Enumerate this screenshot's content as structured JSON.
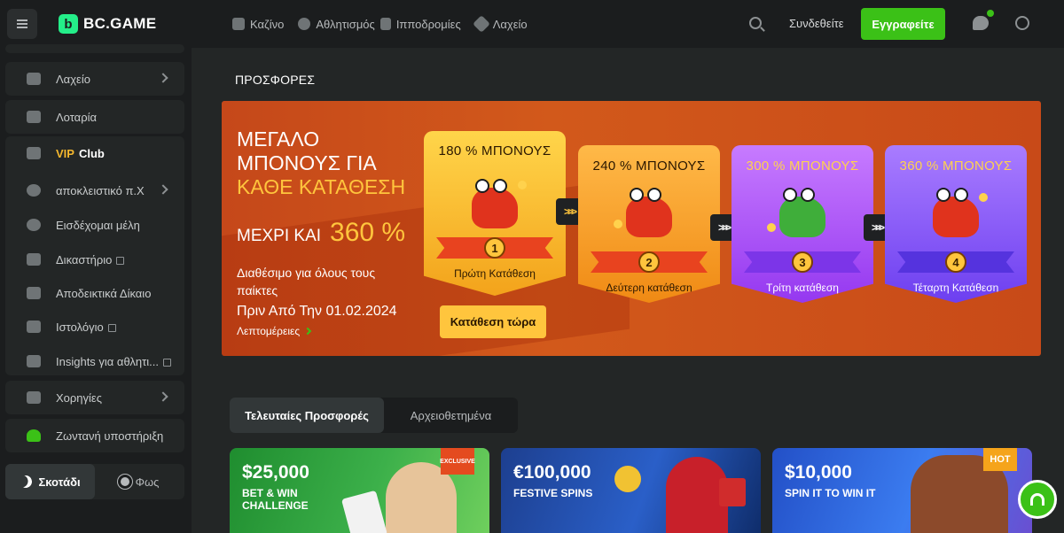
{
  "header": {
    "logo_text": "BC.GAME",
    "nav": [
      {
        "label": "Καζίνο",
        "icon": "casino-icon"
      },
      {
        "label": "Αθλητισμός",
        "icon": "sports-icon"
      },
      {
        "label": "Ιπποδρομίες",
        "icon": "horse-racing-icon"
      },
      {
        "label": "Λαχείο",
        "icon": "lottery-icon"
      }
    ],
    "login_label": "Συνδεθείτε",
    "register_label": "Εγγραφείτε"
  },
  "sidebar": {
    "items": [
      {
        "label": "Λαχείο",
        "icon": "ticket-icon"
      },
      {
        "label": "Λοταρία",
        "icon": "lottery-balls-icon"
      },
      {
        "label_vip": "VIP",
        "label_club": "Club",
        "icon": "crown-icon"
      },
      {
        "label": "αποκλειστικό π.Χ",
        "icon": "medal-icon"
      },
      {
        "label": "Εισδέχομαι μέλη",
        "icon": "referral-icon"
      },
      {
        "label": "Δικαστήριο",
        "icon": "court-icon"
      },
      {
        "label": "Αποδεικτικά Δίκαιο",
        "icon": "fairness-icon"
      },
      {
        "label": "Ιστολόγιο",
        "icon": "blog-icon"
      },
      {
        "label": "Insights για αθλητι...",
        "icon": "insights-icon"
      },
      {
        "label": "Χορηγίες",
        "icon": "sponsorship-icon"
      },
      {
        "label": "Ζωντανή υποστήριξη",
        "icon": "headset-icon"
      }
    ],
    "theme_dark": "Σκοτάδι",
    "theme_light": "Φως"
  },
  "main": {
    "title": "ΠΡΟΣΦΟΡΕΣ",
    "banner": {
      "title_line1": "ΜΕΓΑΛΟ",
      "title_line2": "ΜΠΟΝΟΥΣ ΓΙΑ",
      "title_line3": "ΚΑΘΕ ΚΑΤΑΘΕΣΗ",
      "upto_label": "ΜΕΧΡΙ ΚΑΙ",
      "upto_value": "360 %",
      "available": "Διαθέσιμο για όλους τους παίκτες",
      "date": "Πριν Από Την 01.02.2024",
      "more": "Λεπτομέρειες",
      "deposit_button": "Κατάθεση τώρα",
      "cards": [
        {
          "title": "180 % ΜΠΟΝΟΥΣ",
          "number": "1",
          "label": "Πρώτη Κατάθεση"
        },
        {
          "title": "240 % ΜΠΟΝΟΥΣ",
          "number": "2",
          "label": "Δεύτερη κατάθεση"
        },
        {
          "title": "300 % ΜΠΟΝΟΥΣ",
          "number": "3",
          "label": "Τρίτη κατάθεση"
        },
        {
          "title": "360 % ΜΠΟΝΟΥΣ",
          "number": "4",
          "label": "Τέταρτη Κατάθεση"
        }
      ]
    },
    "tabs": [
      {
        "label": "Τελευταίες Προσφορές"
      },
      {
        "label": "Αρχειοθετημένα"
      }
    ],
    "promos": [
      {
        "amount": "$25,000",
        "line1": "BET & WIN",
        "line2": "CHALLENGE",
        "badge": "EXCLUSIVE"
      },
      {
        "amount": "€100,000",
        "line1": "FESTIVE SPINS",
        "line2": "",
        "badge": ""
      },
      {
        "amount": "$10,000",
        "line1": "SPIN IT TO WIN IT",
        "line2": "",
        "badge": "HOT"
      }
    ]
  },
  "colors": {
    "accent_green": "#3bc117",
    "brand_green": "#24ee89",
    "banner_orange": "#c5481a",
    "gold": "#ffc53d"
  }
}
